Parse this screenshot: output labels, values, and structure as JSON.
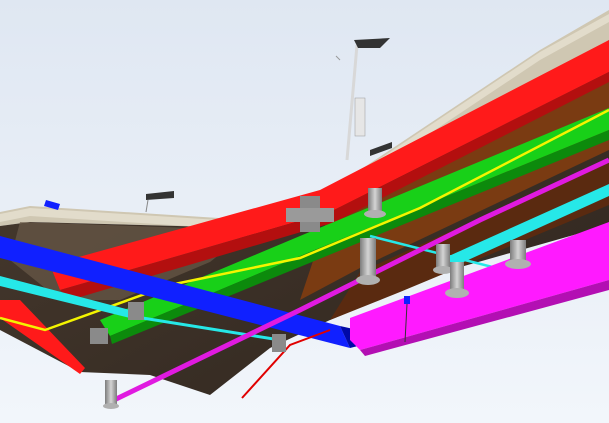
{
  "viewport": {
    "view_mode": "3d-perspective",
    "background": "gradient-sky"
  },
  "scene": {
    "kind": "bim-model",
    "structure": "bridge-deck-underside-with-utility-runs",
    "elements": [
      {
        "name": "deck-slab",
        "color": "#c9c0ac"
      },
      {
        "name": "deck-underside",
        "color": "#3b3027"
      },
      {
        "name": "rust-panel",
        "color": "#7a3b12"
      },
      {
        "name": "red-cable-tray",
        "color": "#ff1a1a"
      },
      {
        "name": "green-duct",
        "color": "#18d018"
      },
      {
        "name": "yellow-pipe",
        "color": "#f4f400"
      },
      {
        "name": "blue-duct",
        "color": "#1020ff"
      },
      {
        "name": "cyan-pipe",
        "color": "#26e8e8"
      },
      {
        "name": "magenta-duct",
        "color": "#ff1aff"
      },
      {
        "name": "magenta-pipe",
        "color": "#e01ae0"
      },
      {
        "name": "pipe-hangers",
        "color": "#9c9c9c"
      },
      {
        "name": "light-pole",
        "color": "#d8d8d8"
      },
      {
        "name": "sign-panels",
        "color": "#333333"
      }
    ]
  }
}
